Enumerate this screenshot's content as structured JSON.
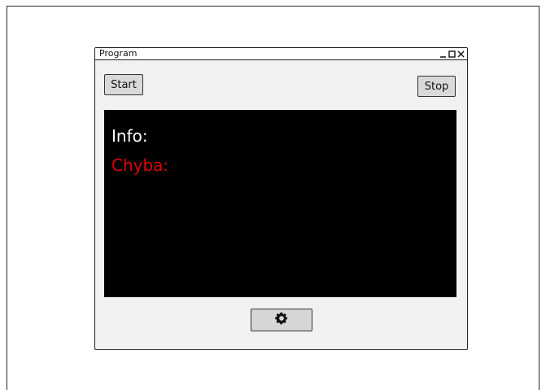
{
  "window": {
    "title": "Program",
    "controls": {
      "minimize_icon": "minimize-icon",
      "maximize_icon": "maximize-icon",
      "close_icon": "close-icon"
    }
  },
  "toolbar": {
    "start_label": "Start",
    "stop_label": "Stop"
  },
  "console": {
    "background": "#000000",
    "lines": [
      {
        "text": "Info:",
        "color": "#ffffff"
      },
      {
        "text": "Chyba:",
        "color": "#e10000"
      }
    ]
  },
  "footer": {
    "settings_icon": "gear-icon"
  }
}
